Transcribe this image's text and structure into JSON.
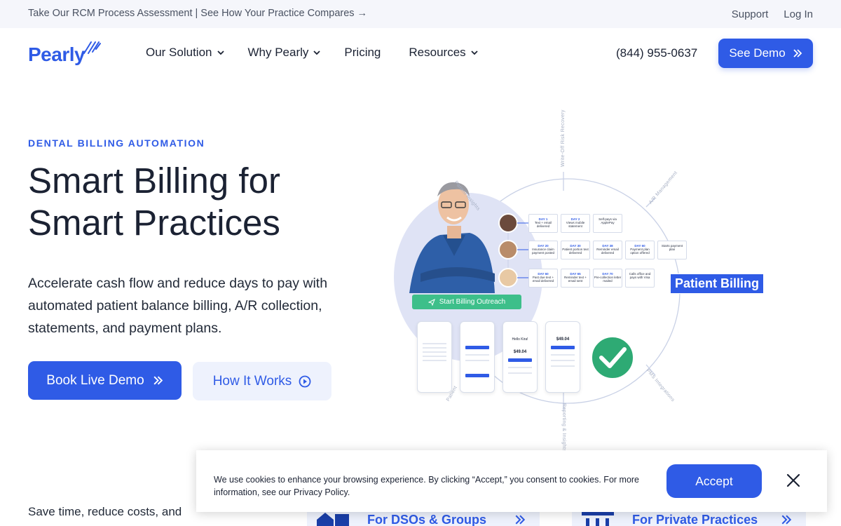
{
  "topbar": {
    "promo": "Take Our RCM Process Assessment | See How Your Practice Compares →",
    "support": "Support",
    "login": "Log In"
  },
  "nav": {
    "logo": "Pearly",
    "items": [
      {
        "label": "Our Solution"
      },
      {
        "label": "Why Pearly"
      },
      {
        "label": "Pricing"
      },
      {
        "label": "Resources"
      }
    ],
    "phone": "(844) 955-0637",
    "cta": "See Demo"
  },
  "hero": {
    "eyebrow": "DENTAL BILLING AUTOMATION",
    "title_line1": "Smart Billing for",
    "title_line2": "Smart Practices",
    "lead": "Accelerate cash flow and reduce days to pay with automated patient balance billing, A/R collection, statements, and payment plans.",
    "primary_cta": "Book Live Demo",
    "secondary_cta": "How It Works"
  },
  "illustration": {
    "tag": "Patient Billing",
    "outreach_button": "Start Billing Outreach",
    "ring_labels": [
      "Write-Off Risk Recovery",
      "A/R Management",
      "PMS Integrations",
      "Reporting & Insights",
      "Patient Insights",
      "Patient"
    ],
    "rows": [
      [
        {
          "day": "DAY 1",
          "text": "Text + email delivered"
        },
        {
          "day": "DAY 2",
          "text": "Views mobile statement"
        },
        {
          "day": "",
          "text": "Self-pays via ApplePay"
        }
      ],
      [
        {
          "day": "DAY 20",
          "text": "Insurance claim payment posted"
        },
        {
          "day": "DAY 30",
          "text": "Patient portion text delivered"
        },
        {
          "day": "DAY 38",
          "text": "Reminder email delivered"
        },
        {
          "day": "DAY 60",
          "text": "Payment plan option offered"
        },
        {
          "day": "",
          "text": "Starts payment plan"
        }
      ],
      [
        {
          "day": "DAY 60",
          "text": "Past due text + email delivered"
        },
        {
          "day": "DAY 65",
          "text": "Reminder text + email sent"
        },
        {
          "day": "DAY 70",
          "text": "Pre-collection letter mailed"
        },
        {
          "day": "",
          "text": "Calls office and pays with Visa"
        }
      ]
    ],
    "phones": [
      {
        "amount": ""
      },
      {
        "amount": ""
      },
      {
        "amount": "$49.04"
      },
      {
        "amount": "$49.04"
      }
    ],
    "greeting": "Hello Kira!",
    "colors": {
      "accent": "#2f5be6",
      "success": "#3dbf8a"
    }
  },
  "below": {
    "text": "Save time, reduce costs, and",
    "card1": "For DSOs & Groups",
    "card2": "For Private Practices"
  },
  "cookie": {
    "message": "We use cookies to enhance your browsing experience. By clicking “Accept,” you consent to cookies. For more information, see our Privacy Policy.",
    "accept": "Accept"
  }
}
